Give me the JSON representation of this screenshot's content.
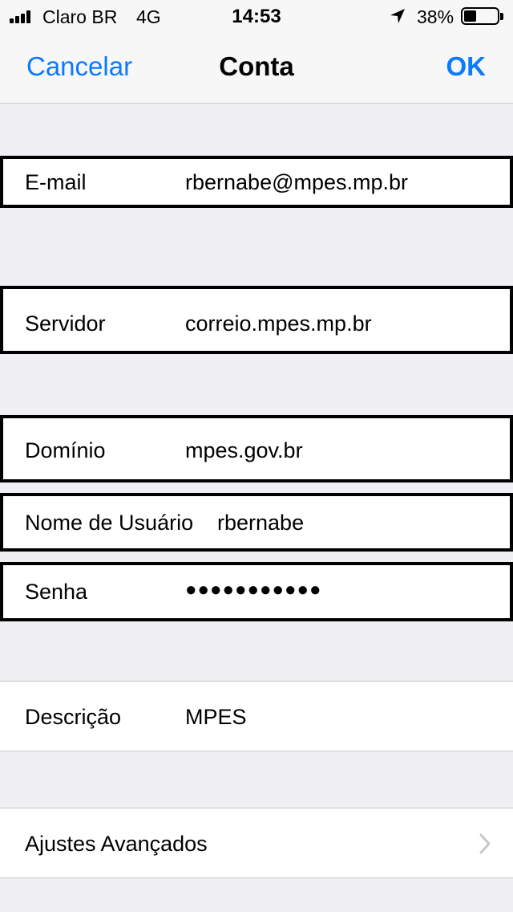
{
  "status_bar": {
    "carrier": "Claro BR",
    "network": "4G",
    "time": "14:53",
    "battery_percent": "38%",
    "battery_level": 0.38
  },
  "nav": {
    "cancel_label": "Cancelar",
    "title": "Conta",
    "ok_label": "OK"
  },
  "fields": {
    "email": {
      "label": "E-mail",
      "value": "rbernabe@mpes.mp.br"
    },
    "server": {
      "label": "Servidor",
      "value": "correio.mpes.mp.br"
    },
    "domain": {
      "label": "Domínio",
      "value": "mpes.gov.br"
    },
    "username": {
      "label": "Nome de Usuário",
      "value": "rbernabe"
    },
    "password": {
      "label": "Senha",
      "value": "●●●●●●●●●●●"
    },
    "description": {
      "label": "Descrição",
      "value": "MPES"
    }
  },
  "advanced": {
    "label": "Ajustes Avançados"
  },
  "colors": {
    "accent": "#0a7aff",
    "background": "#efeff4"
  }
}
